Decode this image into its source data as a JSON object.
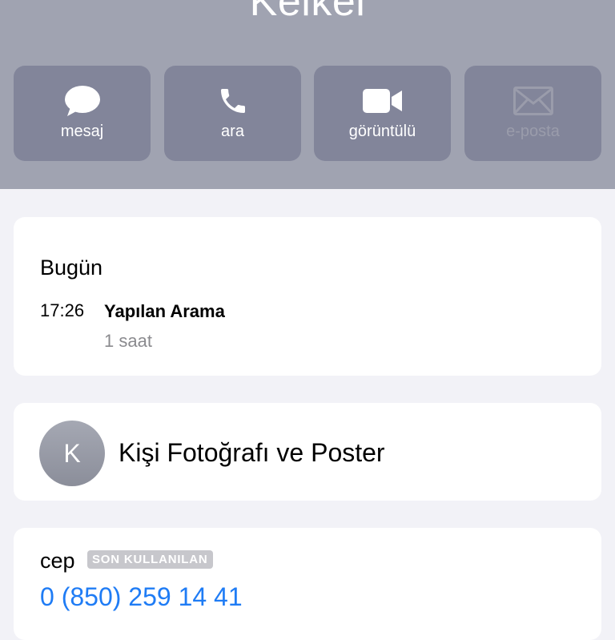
{
  "contact": {
    "name": "Kelkel"
  },
  "actions": [
    {
      "label": "mesaj",
      "icon": "message-bubble-icon"
    },
    {
      "label": "ara",
      "icon": "phone-icon"
    },
    {
      "label": "görüntülü",
      "icon": "video-camera-icon"
    },
    {
      "label": "e-posta",
      "icon": "envelope-icon"
    }
  ],
  "recents": {
    "title": "Bugün",
    "entries": [
      {
        "time": "17:26",
        "type": "Yapılan Arama",
        "duration": "1 saat"
      }
    ]
  },
  "poster": {
    "avatar_initial": "K",
    "label": "Kişi Fotoğrafı ve Poster"
  },
  "phone": {
    "type": "cep",
    "badge": "SON KULLANILAN",
    "number": "0 (850) 259 14 41"
  },
  "colors": {
    "header": "#a0a3b1",
    "button": "#82859a",
    "link": "#1f7cf5",
    "background": "#f2f2f7"
  }
}
